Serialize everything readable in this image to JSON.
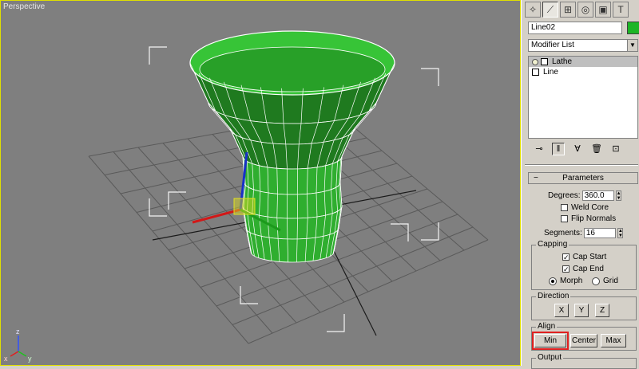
{
  "viewport": {
    "label": "Perspective",
    "axis_x": "x",
    "axis_y": "y",
    "axis_z": "z"
  },
  "panel": {
    "tabs": [
      {
        "icon": "create-icon"
      },
      {
        "icon": "modify-icon"
      },
      {
        "icon": "hierarchy-icon"
      },
      {
        "icon": "motion-icon"
      },
      {
        "icon": "display-icon"
      },
      {
        "icon": "utilities-icon"
      }
    ],
    "object_name": "Line02",
    "object_color": "#1cb526",
    "modifier_list": "Modifier List",
    "stack": [
      "Lathe",
      "Line"
    ],
    "parameters": {
      "title": "Parameters",
      "degrees_label": "Degrees:",
      "degrees_value": "360.0",
      "weld_core": "Weld Core",
      "flip_normals": "Flip Normals",
      "segments_label": "Segments:",
      "segments_value": "16",
      "capping": {
        "title": "Capping",
        "cap_start": "Cap Start",
        "cap_end": "Cap End",
        "morph": "Morph",
        "grid": "Grid"
      },
      "direction": {
        "title": "Direction",
        "x": "X",
        "y": "Y",
        "z": "Z"
      },
      "align": {
        "title": "Align",
        "min": "Min",
        "center": "Center",
        "max": "Max"
      },
      "output": {
        "title": "Output"
      }
    }
  }
}
